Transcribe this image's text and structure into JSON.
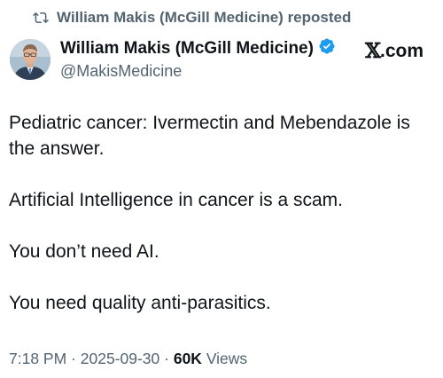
{
  "repost": {
    "text": "William Makis (McGill Medicine) reposted",
    "icon": "repost-icon"
  },
  "author": {
    "display_name": "William Makis (McGill Medicine)",
    "handle": "@MakisMedicine",
    "verified_icon": "verified-badge-icon",
    "verified_color": "#1d9bf0"
  },
  "watermark": {
    "text": ".com",
    "logo": "x-logo-icon"
  },
  "tweet": {
    "paragraphs": [
      "Pediatric cancer: Ivermectin and Mebendazole is the answer.",
      "Artificial Intelligence in cancer is a scam.",
      "You don’t need AI.",
      "You need quality anti-parasitics."
    ]
  },
  "meta": {
    "time": "7:18 PM",
    "separator1": " · ",
    "date": "2025-09-30",
    "separator2": " · ",
    "views_count": "60K",
    "views_label": " Views"
  },
  "colors": {
    "text": "#0f1419",
    "secondary": "#536471",
    "accent": "#1d9bf0"
  }
}
